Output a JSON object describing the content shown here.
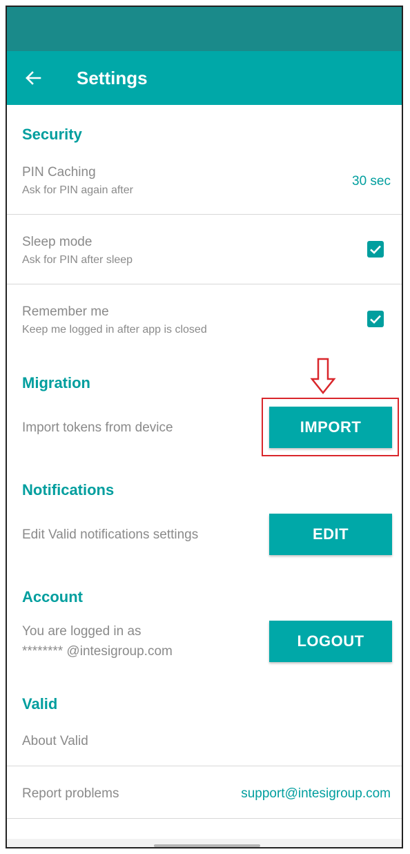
{
  "appbar": {
    "title": "Settings",
    "back_icon": "arrow-left-icon"
  },
  "colors": {
    "accent": "#00a8a8",
    "statusbar": "#1a8a8a",
    "highlight": "#d9262b",
    "text_muted": "#8a8a8a"
  },
  "security": {
    "header": "Security",
    "pin_caching": {
      "title": "PIN Caching",
      "subtitle": "Ask for PIN again after",
      "value": "30 sec"
    },
    "sleep_mode": {
      "title": "Sleep mode",
      "subtitle": "Ask for PIN after sleep",
      "checked": true
    },
    "remember_me": {
      "title": "Remember me",
      "subtitle": "Keep me logged in after app is closed",
      "checked": true
    }
  },
  "migration": {
    "header": "Migration",
    "label": "Import tokens from device",
    "button": "IMPORT"
  },
  "notifications": {
    "header": "Notifications",
    "label": "Edit Valid notifications settings",
    "button": "EDIT"
  },
  "account": {
    "header": "Account",
    "line1": "You are logged in as",
    "line2": "******** @intesigroup.com",
    "button": "LOGOUT"
  },
  "valid": {
    "header": "Valid",
    "about": "About Valid",
    "report": {
      "label": "Report problems",
      "email": "support@intesigroup.com"
    }
  }
}
